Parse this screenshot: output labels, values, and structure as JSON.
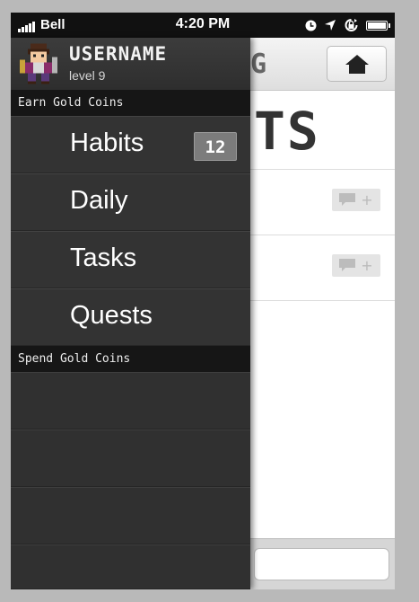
{
  "status_bar": {
    "carrier": "Bell",
    "time": "4:20 PM"
  },
  "header": {
    "title_fragment": "G",
    "big_title_fragment": "TS"
  },
  "drawer": {
    "username": "USERNAME",
    "level": "level 9",
    "earn_section": "Earn Gold Coins",
    "items": [
      {
        "label": "Habits",
        "badge": "12"
      },
      {
        "label": "Daily"
      },
      {
        "label": "Tasks"
      },
      {
        "label": "Quests"
      }
    ],
    "spend_section": "Spend Gold Coins"
  },
  "content_rows": [
    {
      "note_plus": "+"
    },
    {
      "note_plus": "+"
    }
  ],
  "icons": [
    "signal-bars-icon",
    "clock-icon",
    "location-arrow-icon",
    "rotation-lock-icon",
    "battery-icon",
    "home-icon",
    "comment-icon",
    "avatar-sprite"
  ]
}
